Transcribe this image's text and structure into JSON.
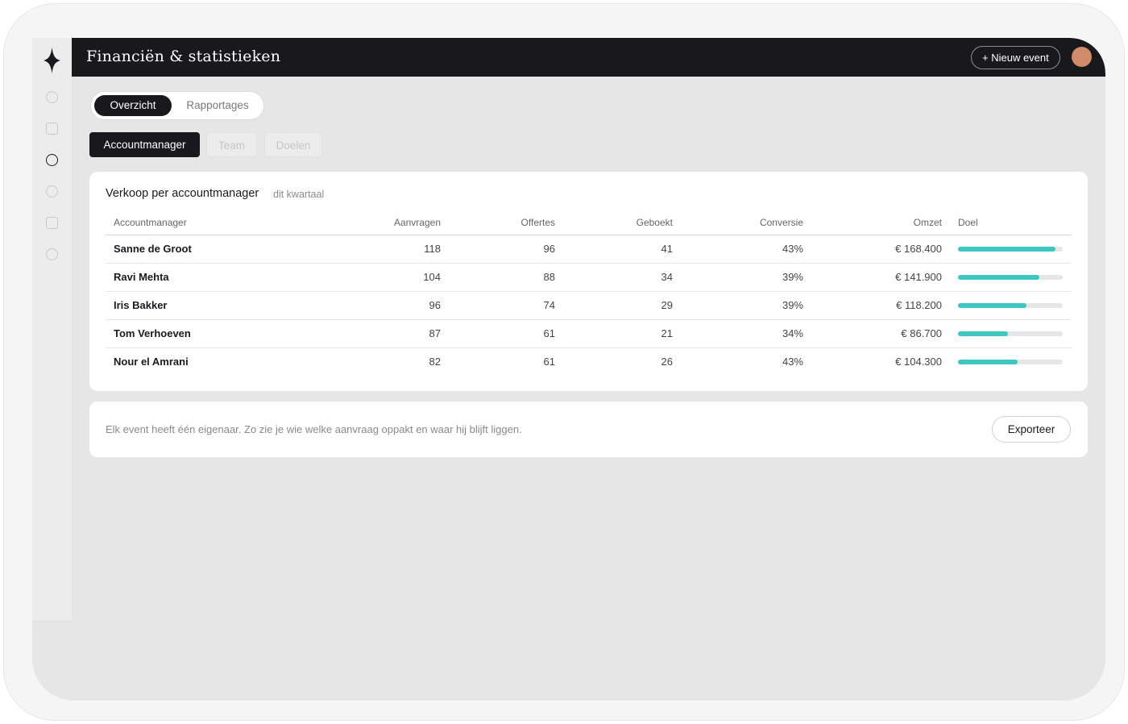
{
  "header": {
    "title": "Financiën & statistieken",
    "new_event_label": "+ Nieuw event"
  },
  "colors": {
    "dark": "#19191d",
    "accent": "#3ec6c3",
    "avatar": "#d08c6a"
  },
  "sidebar": {
    "icons": [
      "circle",
      "square",
      "circle-active",
      "circle",
      "square",
      "circle"
    ]
  },
  "view_toggle": {
    "active": "Overzicht",
    "inactive": "Rapportages"
  },
  "tabs": [
    {
      "label": "Accountmanager",
      "active": true
    },
    {
      "label": "Team",
      "active": false
    },
    {
      "label": "Doelen",
      "active": false
    }
  ],
  "sales_card": {
    "title": "Verkoop per accountmanager",
    "subtitle": "dit kwartaal",
    "columns": [
      "Accountmanager",
      "Aanvragen",
      "Offertes",
      "Geboekt",
      "Conversie",
      "Omzet",
      "Doel"
    ],
    "rows": [
      {
        "name": "Sanne de Groot",
        "aanvragen": "118",
        "offertes": "96",
        "geboekt": "41",
        "conversie": "43%",
        "omzet": "€ 168.400",
        "doel": 0.93
      },
      {
        "name": "Ravi Mehta",
        "aanvragen": "104",
        "offertes": "88",
        "geboekt": "34",
        "conversie": "39%",
        "omzet": "€ 141.900",
        "doel": 0.78
      },
      {
        "name": "Iris Bakker",
        "aanvragen": "96",
        "offertes": "74",
        "geboekt": "29",
        "conversie": "39%",
        "omzet": "€ 118.200",
        "doel": 0.65
      },
      {
        "name": "Tom Verhoeven",
        "aanvragen": "87",
        "offertes": "61",
        "geboekt": "21",
        "conversie": "34%",
        "omzet": "€ 86.700",
        "doel": 0.48
      },
      {
        "name": "Nour el Amrani",
        "aanvragen": "82",
        "offertes": "61",
        "geboekt": "26",
        "conversie": "43%",
        "omzet": "€ 104.300",
        "doel": 0.57
      }
    ]
  },
  "footer_card": {
    "text": "Elk event heeft één eigenaar. Zo zie je wie welke aanvraag oppakt en waar hij blijft liggen.",
    "export_label": "Exporteer"
  }
}
